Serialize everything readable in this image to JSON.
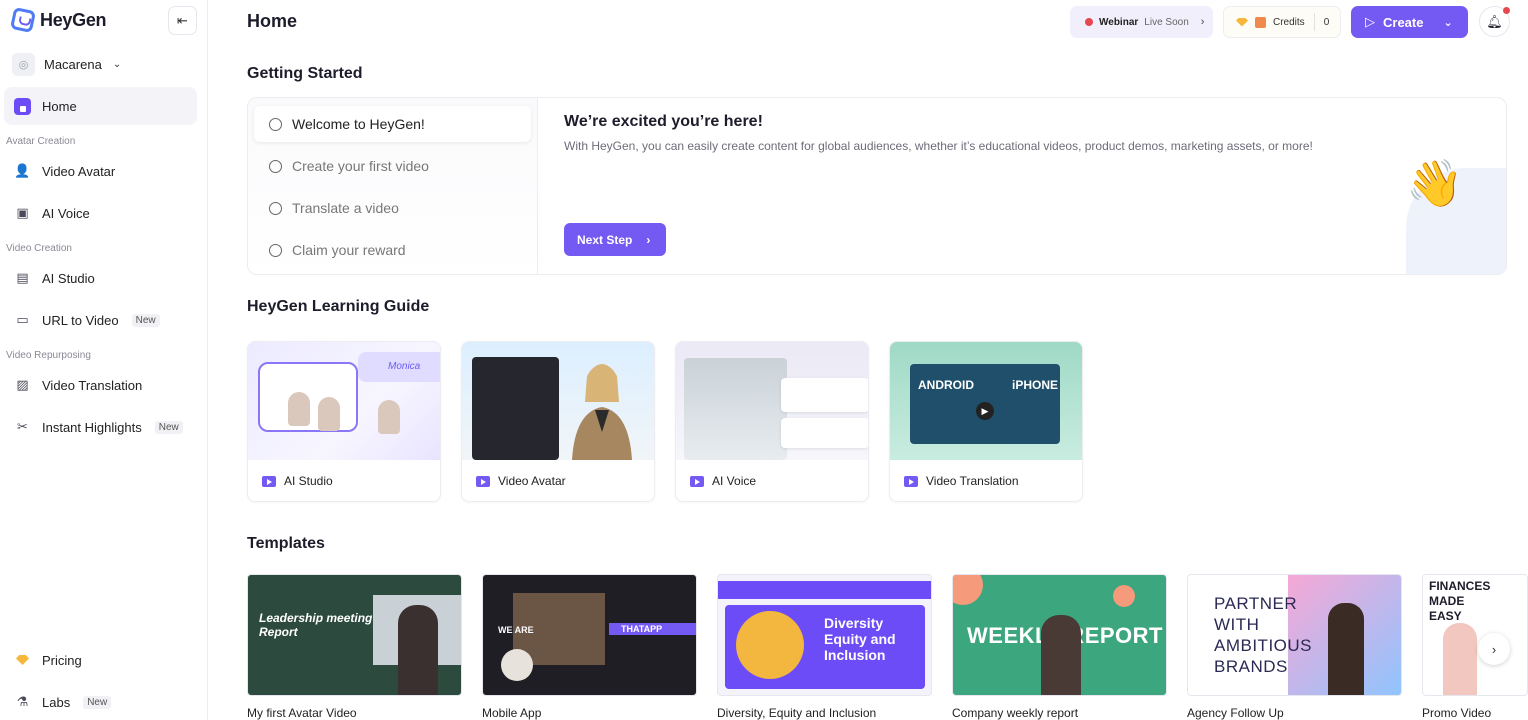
{
  "sidebar": {
    "logo_text": "HeyGen",
    "workspace": "Macarena",
    "items": [
      {
        "label": "Home"
      },
      {
        "label": "Video Avatar"
      },
      {
        "label": "AI Voice"
      },
      {
        "label": "AI Studio"
      },
      {
        "label": "URL to Video",
        "badge": "New"
      },
      {
        "label": "Video Translation"
      },
      {
        "label": "Instant Highlights",
        "badge": "New"
      },
      {
        "label": "Pricing"
      },
      {
        "label": "Labs",
        "badge": "New"
      }
    ],
    "sections": [
      "Avatar Creation",
      "Video Creation",
      "Video Repurposing"
    ]
  },
  "header": {
    "title": "Home",
    "webinar_bold": "Webinar",
    "webinar_rest": "Live Soon",
    "credits_label": "Credits",
    "credits_value": "0",
    "create_label": "Create"
  },
  "getting_started": {
    "title": "Getting Started",
    "steps": [
      "Welcome to HeyGen!",
      "Create your first video",
      "Translate a video",
      "Claim your reward"
    ],
    "heading": "We’re excited you’re here!",
    "description": "With HeyGen, you can easily create content for global audiences, whether it’s educational videos, product demos, marketing assets, or more!",
    "next_label": "Next Step"
  },
  "learning": {
    "title": "HeyGen Learning Guide",
    "cards": [
      "AI Studio",
      "Video Avatar",
      "AI Voice",
      "Video Translation"
    ]
  },
  "templates": {
    "title": "Templates",
    "items": [
      {
        "name": "My first Avatar Video",
        "thumb_text": "Leadership meeting Report"
      },
      {
        "name": "Mobile App",
        "thumb_text": "WE ARE",
        "thumb_text2": "THATAPP"
      },
      {
        "name": "Diversity, Equity and Inclusion",
        "thumb_text": "Diversity Equity and Inclusion"
      },
      {
        "name": "Company weekly report",
        "thumb_text": "WEEKLY REPORT"
      },
      {
        "name": "Agency Follow Up",
        "thumb_text": "PARTNER WITH AMBITIOUS BRANDS"
      },
      {
        "name": "Promo Video",
        "thumb_text": "FINANCES MADE EASY"
      }
    ]
  },
  "thumb_texts": {
    "monica": "Monica",
    "android": "ANDROID",
    "iphone": "iPHONE"
  },
  "colors": {
    "accent": "#7559f3",
    "live_dot": "#e5484d"
  }
}
